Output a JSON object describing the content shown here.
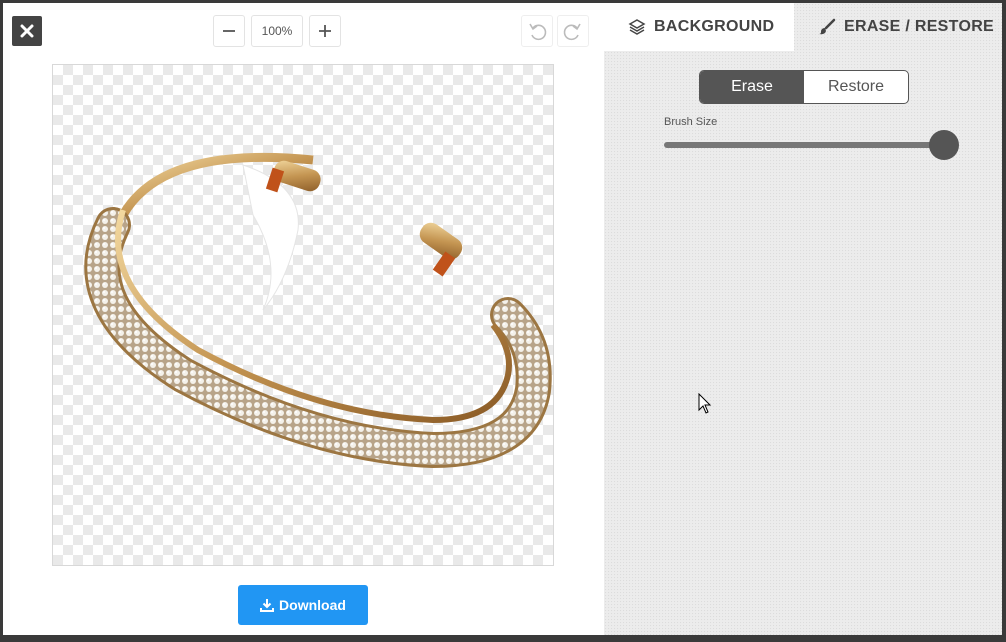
{
  "toolbar": {
    "zoom_value": "100%"
  },
  "editor": {
    "image_alt": "bracelet"
  },
  "download": {
    "label": "Download"
  },
  "panel": {
    "tabs": [
      {
        "label": "BACKGROUND",
        "icon": "layers-icon"
      },
      {
        "label": "ERASE / RESTORE",
        "icon": "brush-icon"
      }
    ],
    "mode": {
      "erase_label": "Erase",
      "restore_label": "Restore",
      "active": "Erase"
    },
    "brush": {
      "label": "Brush Size",
      "value_fraction": 1.0
    }
  },
  "colors": {
    "accent": "#2196f3",
    "dark": "#555555"
  }
}
